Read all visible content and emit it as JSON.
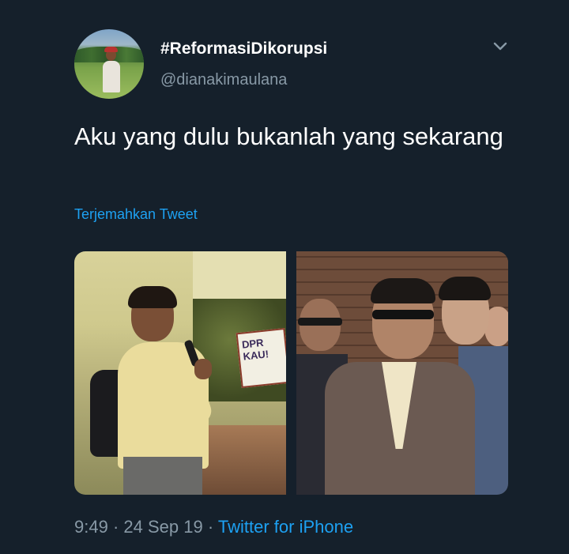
{
  "tweet": {
    "display_name": "#ReformasiDikorupsi",
    "handle": "@dianakimaulana",
    "text": "Aku yang dulu bukanlah yang sekarang",
    "translate_label": "Terjemahkan Tweet",
    "time": "9:49",
    "date": "24 Sep 19",
    "separator": "·",
    "source": "Twitter for iPhone",
    "menu_icon": "chevron-down-icon"
  },
  "media": {
    "left_photo": {
      "sign_line1": "DPR",
      "sign_line2": "KAU!"
    }
  },
  "colors": {
    "background": "#15202b",
    "text": "#ffffff",
    "secondary": "#8899a6",
    "link": "#1da1f2"
  }
}
